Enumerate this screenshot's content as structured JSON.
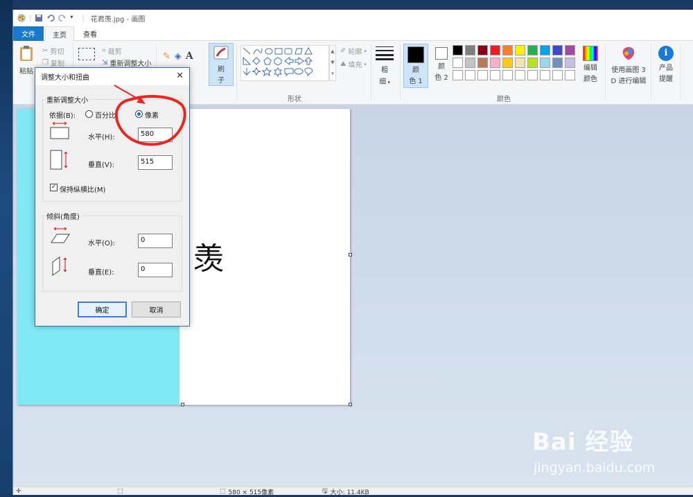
{
  "app": {
    "window_title": "花君羡.jpg - 画图"
  },
  "tabs": [
    {
      "label": "文件"
    },
    {
      "label": "主页"
    },
    {
      "label": "查看"
    }
  ],
  "ribbon": {
    "clipboard": {
      "paste": "粘贴",
      "cut": "剪切",
      "copy": "复制",
      "label_partial": "剪"
    },
    "image": {
      "select": "选",
      "crop": "裁剪",
      "resize": "重新调整大小"
    },
    "brushes": {
      "line1": "刷",
      "line2": "子"
    },
    "shapes": {
      "outline": "轮廓",
      "fill": "填充",
      "group_label": "形状"
    },
    "size": {
      "line1": "粗",
      "line2": "细"
    },
    "color1": {
      "line1": "颜",
      "line2": "色 1"
    },
    "color2": {
      "line1": "颜",
      "line2": "色 2"
    },
    "edit_colors": {
      "line1": "编辑",
      "line2": "颜色"
    },
    "paint3d": {
      "line1": "使用画图 3",
      "line2": "D 进行编辑"
    },
    "product": {
      "line1": "产品",
      "line2": "提醒"
    },
    "colors_group_label": "颜色",
    "palette_row1": [
      "#000000",
      "#7f7f7f",
      "#880015",
      "#ed1c24",
      "#ff7f27",
      "#fff200",
      "#22b14c",
      "#00a2e8",
      "#3f48cc",
      "#a349a4"
    ],
    "palette_row2": [
      "#ffffff",
      "#c3c3c3",
      "#b97a57",
      "#ffaec9",
      "#ffc90e",
      "#efe4b0",
      "#b5e61d",
      "#99d9ea",
      "#7092be",
      "#c8bfe7"
    ],
    "palette_row3": [
      "#ffffff",
      "#ffffff",
      "#ffffff",
      "#ffffff",
      "#ffffff",
      "#ffffff",
      "#ffffff",
      "#ffffff",
      "#ffffff",
      "#ffffff"
    ]
  },
  "canvas": {
    "text": "羡"
  },
  "dialog": {
    "title": "调整大小和扭曲",
    "resize_legend": "重新调整大小",
    "by_label": "依据(B):",
    "percent_label": "百分比",
    "pixel_label": "像素",
    "h_label": "水平(H):",
    "h_value": "580",
    "v_label": "垂直(V):",
    "v_value": "515",
    "keep_ratio": "保持纵横比(M)",
    "skew_legend": "倾斜(角度)",
    "skew_h_label": "水平(O):",
    "skew_h_value": "0",
    "skew_v_label": "垂直(E):",
    "skew_v_value": "0",
    "ok": "确定",
    "cancel": "取消"
  },
  "status": {
    "dimensions": "580 × 515像素",
    "size": "大小: 11.4KB"
  },
  "watermark": {
    "brand": "Bai 经验",
    "url": "jingyan.baidu.com"
  }
}
